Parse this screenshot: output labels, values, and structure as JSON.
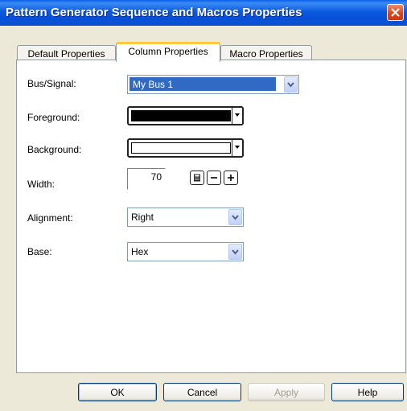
{
  "window": {
    "title": "Pattern Generator Sequence and Macros Properties"
  },
  "tabs": [
    {
      "label": "Default Properties"
    },
    {
      "label": "Column Properties"
    },
    {
      "label": "Macro Properties"
    }
  ],
  "active_tab": "Column Properties",
  "form": {
    "bus_signal": {
      "label": "Bus/Signal:",
      "value": "My Bus 1"
    },
    "foreground": {
      "label": "Foreground:",
      "color": "#000000"
    },
    "background": {
      "label": "Background:",
      "color": "#ffffff"
    },
    "width": {
      "label": "Width:",
      "value": "70"
    },
    "alignment": {
      "label": "Alignment:",
      "value": "Right"
    },
    "base": {
      "label": "Base:",
      "value": "Hex"
    }
  },
  "buttons": {
    "ok": "OK",
    "cancel": "Cancel",
    "apply": "Apply",
    "help": "Help"
  },
  "icons": {
    "close": "close-icon",
    "dropdown": "chevron-down-icon",
    "calculator": "calculator-icon",
    "minus": "minus-icon",
    "plus": "plus-icon"
  },
  "colors": {
    "title_bar": "#0a5fe8",
    "dialog_bg": "#ece9d8",
    "tab_highlight": "#ffc83c",
    "selection": "#316ac5",
    "close_button": "#d8461f"
  }
}
